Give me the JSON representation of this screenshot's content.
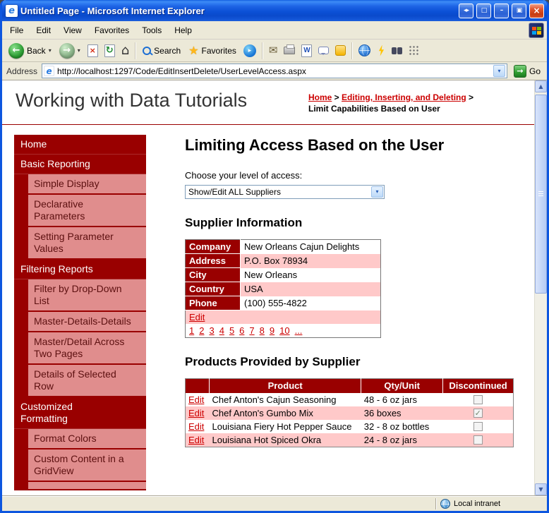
{
  "colors": {
    "maroon": "#990000",
    "sidebar_pink": "#E08D8D",
    "row_pink": "#FFC9C9",
    "link_red": "#CC0000",
    "titlebar_blue": "#0D56DF"
  },
  "icons": {
    "ie_logo": "e",
    "window_pan": "◂▸",
    "window_maximize": "□",
    "window_minimize": "–",
    "window_restore": "▣",
    "window_close": "×",
    "back_arrow": "←",
    "forward_arrow": "→",
    "dropdown_arrow": "▾",
    "stop_x": "×",
    "refresh_arrows": "↻",
    "home_house": "⌂",
    "star": "★",
    "media_play": "▸",
    "mail_envelope": "✉",
    "word_w": "W",
    "go_arrow": "→",
    "combo_arrow": "▾",
    "scroll_up": "▲",
    "scroll_down": "▼",
    "check": "✓"
  },
  "window": {
    "title": "Untitled Page - Microsoft Internet Explorer"
  },
  "menu": {
    "items": [
      "File",
      "Edit",
      "View",
      "Favorites",
      "Tools",
      "Help"
    ]
  },
  "toolbar": {
    "back": "Back",
    "search": "Search",
    "favorites": "Favorites"
  },
  "address": {
    "label": "Address",
    "url": "http://localhost:1297/Code/EditInsertDelete/UserLevelAccess.aspx",
    "go": "Go"
  },
  "header": {
    "site_title": "Working with Data Tutorials",
    "breadcrumb": [
      {
        "label": "Home",
        "link": true
      },
      {
        "label": "Editing, Inserting, and Deleting",
        "link": true
      },
      {
        "label": "Limit Capabilities Based on User",
        "link": false
      }
    ]
  },
  "sidebar": {
    "items": [
      {
        "label": "Home",
        "level": 0
      },
      {
        "label": "Basic Reporting",
        "level": 0
      },
      {
        "label": "Simple Display",
        "level": 1
      },
      {
        "label": "Declarative Parameters",
        "level": 1
      },
      {
        "label": "Setting Parameter Values",
        "level": 1
      },
      {
        "label": "Filtering Reports",
        "level": 0
      },
      {
        "label": "Filter by Drop-Down List",
        "level": 1
      },
      {
        "label": "Master-Details-Details",
        "level": 1
      },
      {
        "label": "Master/Detail Across Two Pages",
        "level": 1
      },
      {
        "label": "Details of Selected Row",
        "level": 1
      },
      {
        "label": "Customized Formatting",
        "level": 0
      },
      {
        "label": "Format Colors",
        "level": 1
      },
      {
        "label": "Custom Content in a GridView",
        "level": 1
      }
    ]
  },
  "main": {
    "title": "Limiting Access Based on the User",
    "access_label": "Choose your level of access:",
    "access_selected": "Show/Edit ALL Suppliers",
    "supplier_heading": "Supplier Information",
    "supplier_fields": [
      {
        "field": "Company",
        "value": "New Orleans Cajun Delights"
      },
      {
        "field": "Address",
        "value": "P.O. Box 78934"
      },
      {
        "field": "City",
        "value": "New Orleans"
      },
      {
        "field": "Country",
        "value": "USA"
      },
      {
        "field": "Phone",
        "value": "(100) 555-4822"
      }
    ],
    "edit_label": "Edit",
    "pager": [
      "1",
      "2",
      "3",
      "4",
      "5",
      "6",
      "7",
      "8",
      "9",
      "10",
      "..."
    ],
    "products_heading": "Products Provided by Supplier",
    "products_headers": [
      "Product",
      "Qty/Unit",
      "Discontinued"
    ],
    "products": [
      {
        "product": "Chef Anton's Cajun Seasoning",
        "qty": "48 - 6 oz jars",
        "discontinued": false
      },
      {
        "product": "Chef Anton's Gumbo Mix",
        "qty": "36 boxes",
        "discontinued": true
      },
      {
        "product": "Louisiana Fiery Hot Pepper Sauce",
        "qty": "32 - 8 oz bottles",
        "discontinued": false
      },
      {
        "product": "Louisiana Hot Spiced Okra",
        "qty": "24 - 8 oz jars",
        "discontinued": false
      }
    ]
  },
  "status": {
    "zone": "Local intranet"
  }
}
